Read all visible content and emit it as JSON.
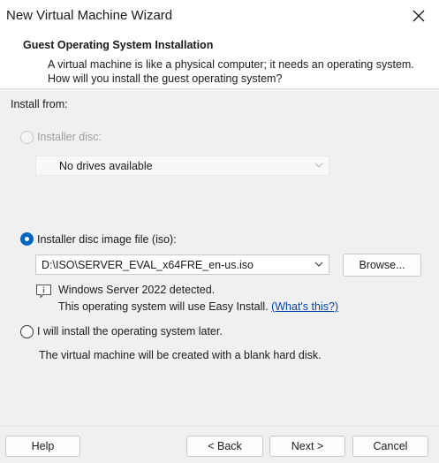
{
  "window": {
    "title": "New Virtual Machine Wizard",
    "close_icon": "close-icon"
  },
  "header": {
    "title": "Guest Operating System Installation",
    "description": "A virtual machine is like a physical computer; it needs an operating system. How will you install the guest operating system?"
  },
  "install_from": {
    "label": "Install from:",
    "installer_disc": {
      "label": "Installer disc:",
      "selected": false,
      "enabled": false,
      "dropdown_value": "No drives available"
    },
    "iso": {
      "label": "Installer disc image file (iso):",
      "selected": true,
      "path": "D:\\ISO\\SERVER_EVAL_x64FRE_en-us.iso",
      "browse_label": "Browse...",
      "detected_text": "Windows Server 2022 detected.",
      "easy_install_text": "This operating system will use Easy Install.",
      "whats_this_link": "(What's this?)"
    },
    "later": {
      "label": "I will install the operating system later.",
      "selected": false,
      "description": "The virtual machine will be created with a blank hard disk."
    }
  },
  "footer": {
    "help": "Help",
    "back": "< Back",
    "next": "Next >",
    "cancel": "Cancel"
  }
}
